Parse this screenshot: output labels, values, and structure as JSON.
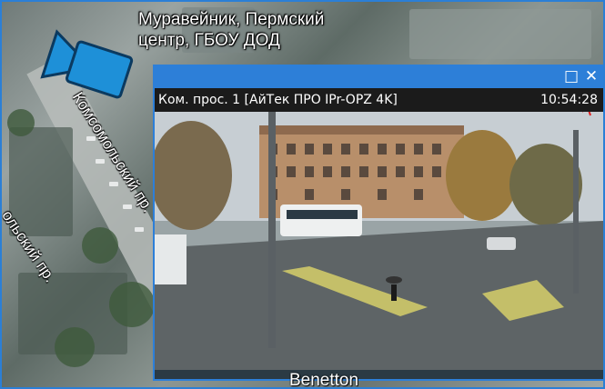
{
  "map": {
    "place_label_line1": "Муравейник, Пермский",
    "place_label_line2": "центр, ГБОУ ДОД",
    "street_1": "Комсомольский пр.",
    "street_2": "ольский пр.",
    "bottom_label": "Benetton"
  },
  "camera_window": {
    "name": "Ком. прос. 1 [АйТек ПРО IPr-OPZ 4K]",
    "time": "10:54:28",
    "maximize_glyph": "□",
    "close_glyph": "✕",
    "motion_icon": "running-person-icon"
  },
  "colors": {
    "accent": "#2d7fd8",
    "camera_marker": "#1e90d8",
    "alert": "#e02020"
  }
}
